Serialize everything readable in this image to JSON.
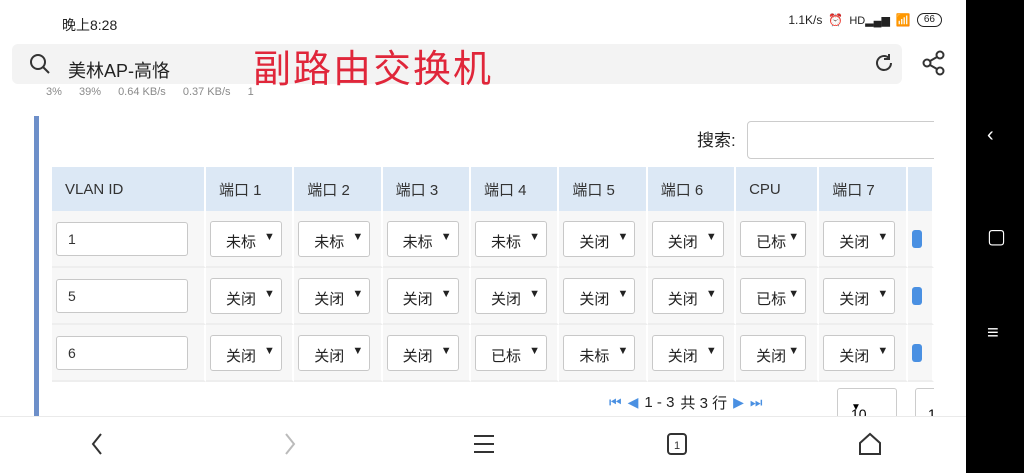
{
  "status_bar": {
    "time": "晚上8:28",
    "speed": "1.1K/s",
    "signal_label": "HD",
    "battery": "66"
  },
  "browser": {
    "site_title": "美林AP-高恪"
  },
  "overlay": {
    "title": "副路由交换机"
  },
  "stats_row": {
    "cpu": "3%",
    "mem": "39%",
    "up": "0.64 KB/s",
    "down": "0.37 KB/s",
    "count": "1"
  },
  "search": {
    "label": "搜索:",
    "value": ""
  },
  "table": {
    "headers": [
      "VLAN ID",
      "端口 1",
      "端口 2",
      "端口 3",
      "端口 4",
      "端口 5",
      "端口 6",
      "CPU",
      "端口 7"
    ],
    "rows": [
      {
        "vlan_id": "1",
        "cells": [
          "未标",
          "未标",
          "未标",
          "未标",
          "关闭",
          "关闭",
          "已标",
          "关闭"
        ]
      },
      {
        "vlan_id": "5",
        "cells": [
          "关闭",
          "关闭",
          "关闭",
          "关闭",
          "关闭",
          "关闭",
          "已标",
          "关闭"
        ]
      },
      {
        "vlan_id": "6",
        "cells": [
          "关闭",
          "关闭",
          "关闭",
          "已标",
          "未标",
          "关闭",
          "关闭",
          "关闭"
        ]
      }
    ]
  },
  "pagination": {
    "range": "1 - 3",
    "total_label": "共 3 行",
    "page_size": "10",
    "page": "1"
  },
  "colors": {
    "overlay_red": "#e0263a",
    "accent_blue": "#4a90e2",
    "header_bg": "#dce8f5"
  },
  "icons": [
    "search-icon",
    "reload-icon",
    "share-icon",
    "back-icon",
    "forward-icon",
    "menu-icon",
    "tabs-icon",
    "home-icon",
    "sys-back-icon",
    "sys-home-icon",
    "sys-menu-icon"
  ]
}
